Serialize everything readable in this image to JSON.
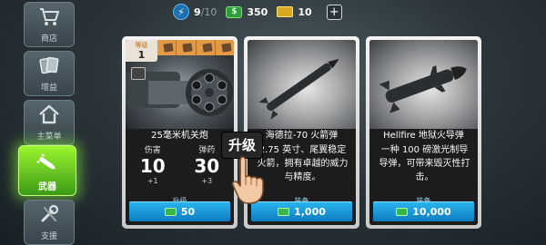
{
  "topbar": {
    "energy": {
      "current": "9",
      "max": "/10",
      "icon": "lightning-icon"
    },
    "cash": {
      "value": "350",
      "icon": "cash-icon"
    },
    "gold": {
      "value": "10",
      "icon": "gold-bar-icon"
    },
    "add_label": "+"
  },
  "sidebar": {
    "items": [
      {
        "label": "商店",
        "icon": "cart-icon",
        "active": false
      },
      {
        "label": "增益",
        "icon": "cards-icon",
        "active": false
      },
      {
        "label": "主菜单",
        "icon": "home-icon",
        "active": false
      },
      {
        "label": "武器",
        "icon": "missile-icon",
        "active": true
      },
      {
        "label": "支援",
        "icon": "wrench-icon",
        "active": false
      }
    ]
  },
  "cards": [
    {
      "level_label": "等级",
      "level_value": "1",
      "title": "25毫米机关炮",
      "stats": [
        {
          "name": "伤害",
          "value": "10",
          "increment": "+1"
        },
        {
          "name": "弹药",
          "value": "30",
          "increment": "+3"
        }
      ],
      "action_label": "升级",
      "price": "50"
    },
    {
      "title": "海德拉-70 火箭弹",
      "description": "2.75 英寸、尾翼稳定火箭，拥有卓越的威力与精度。",
      "action_label": "装备",
      "price": "1,000"
    },
    {
      "title": "Hellfire 地狱火导弹",
      "description": "一种 100 磅激光制导导弹，可带来毁灭性打击。",
      "action_label": "装备",
      "price": "10,000"
    }
  ],
  "tutorial": {
    "callout": "升级"
  },
  "colors": {
    "accent_green": "#7fe02a",
    "button_blue": "#1a97d8",
    "tier_orange": "#e39a47"
  }
}
